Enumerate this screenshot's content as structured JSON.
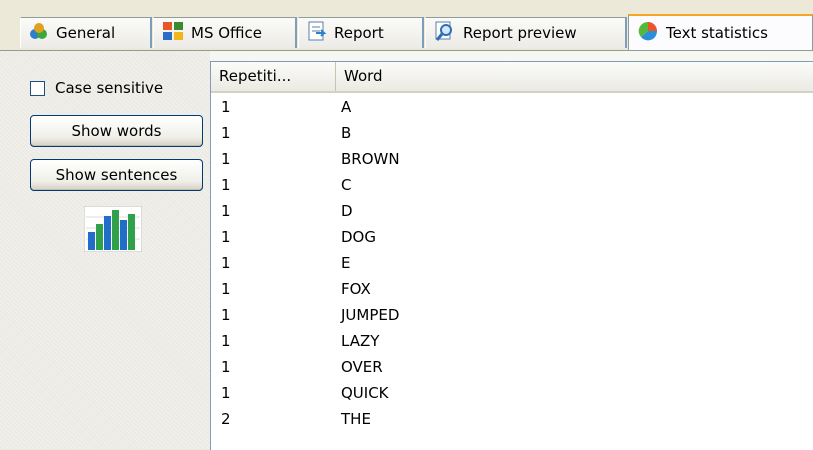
{
  "tabs": [
    {
      "label": "General",
      "icon": "general-icon",
      "active": false
    },
    {
      "label": "MS Office",
      "icon": "ms-office-icon",
      "active": false
    },
    {
      "label": "Report",
      "icon": "report-icon",
      "active": false
    },
    {
      "label": "Report preview",
      "icon": "report-preview-icon",
      "active": false
    },
    {
      "label": "Text statistics",
      "icon": "text-statistics-icon",
      "active": true
    }
  ],
  "options": {
    "case_sensitive_label": "Case sensitive",
    "case_sensitive_checked": false,
    "show_words_label": "Show words",
    "show_sentences_label": "Show sentences",
    "chart_icon": "bar-chart-icon"
  },
  "table": {
    "columns": [
      "Repetiti...",
      "Word"
    ],
    "rows": [
      {
        "rep": "1",
        "word": "A"
      },
      {
        "rep": "1",
        "word": "B"
      },
      {
        "rep": "1",
        "word": "BROWN"
      },
      {
        "rep": "1",
        "word": "C"
      },
      {
        "rep": "1",
        "word": "D"
      },
      {
        "rep": "1",
        "word": "DOG"
      },
      {
        "rep": "1",
        "word": "E"
      },
      {
        "rep": "1",
        "word": "FOX"
      },
      {
        "rep": "1",
        "word": "JUMPED"
      },
      {
        "rep": "1",
        "word": "LAZY"
      },
      {
        "rep": "1",
        "word": "OVER"
      },
      {
        "rep": "1",
        "word": "QUICK"
      },
      {
        "rep": "2",
        "word": "THE"
      }
    ]
  }
}
